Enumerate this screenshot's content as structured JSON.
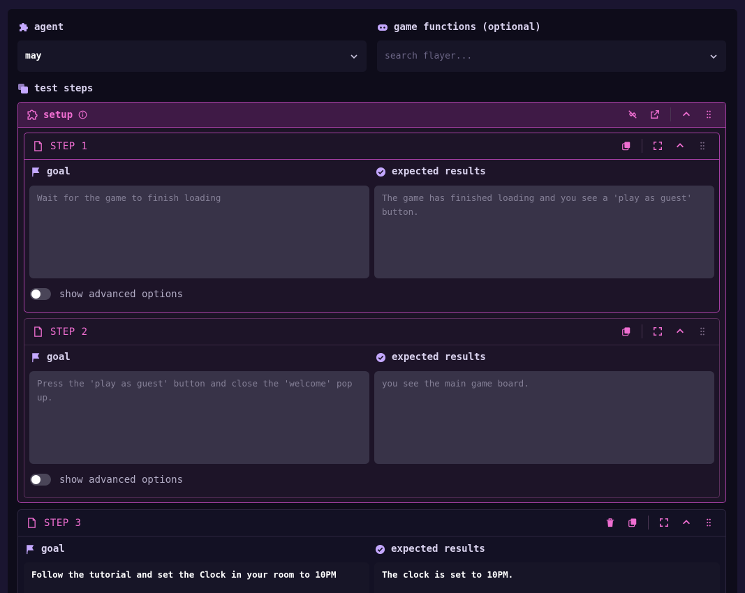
{
  "agent": {
    "label": "agent",
    "value": "may"
  },
  "game_functions": {
    "label": "game functions (optional)",
    "placeholder": "search flayer..."
  },
  "test_steps_label": "test steps",
  "setup": {
    "title": "setup"
  },
  "steps": [
    {
      "title": "STEP 1",
      "goal_label": "goal",
      "expected_label": "expected results",
      "goal_placeholder": "Wait for the game to finish loading",
      "expected_placeholder": "The game has finished loading and you see a 'play as guest' button.",
      "advanced_label": "show advanced options"
    },
    {
      "title": "STEP 2",
      "goal_label": "goal",
      "expected_label": "expected results",
      "goal_placeholder": "Press the 'play as guest' button and close the 'welcome' pop up.",
      "expected_placeholder": "you see the main game board.",
      "advanced_label": "show advanced options"
    },
    {
      "title": "STEP 3",
      "goal_label": "goal",
      "expected_label": "expected results",
      "goal_value": "Follow the tutorial and set the Clock in your room to 10PM",
      "expected_value": "The clock is set to 10PM."
    }
  ],
  "colors": {
    "accent": "#ef6ed1",
    "label": "#c4a8ff",
    "border": "#a43fa3"
  }
}
